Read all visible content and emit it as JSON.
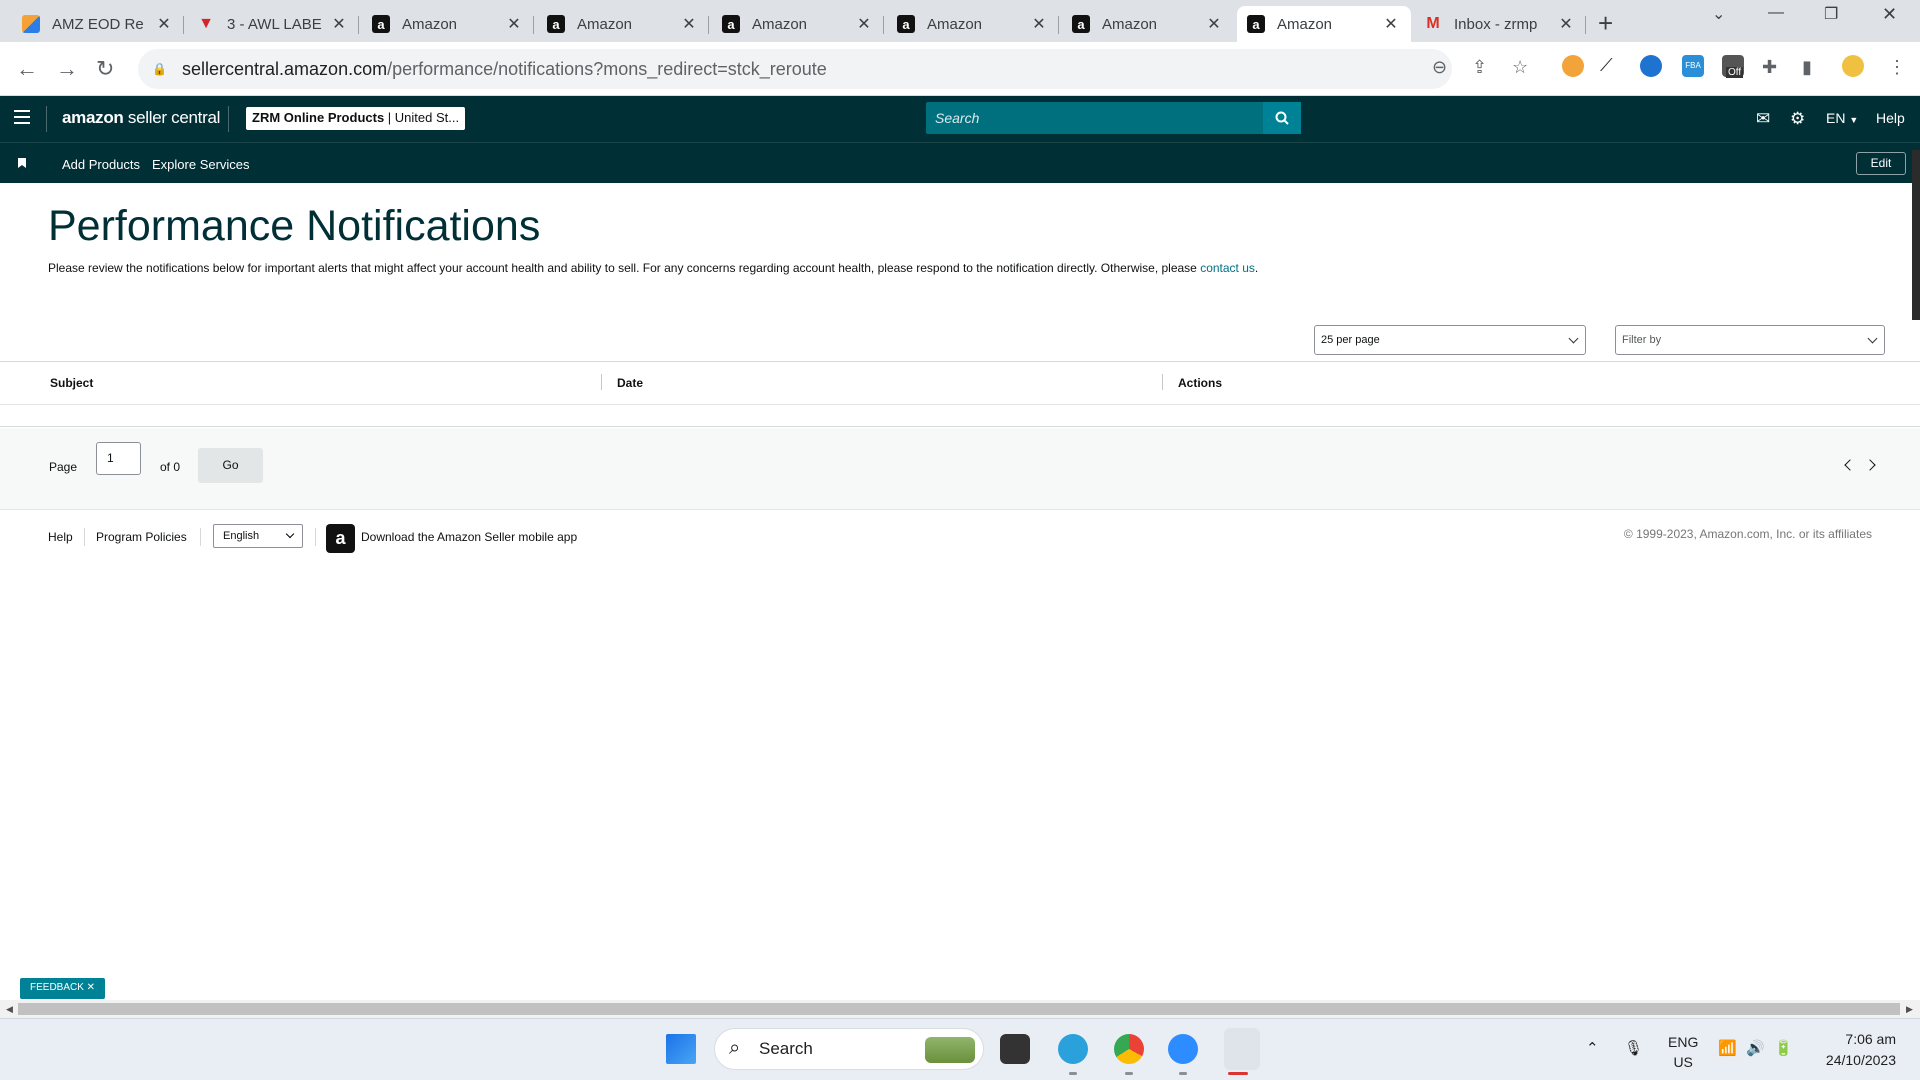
{
  "browser": {
    "tabs": [
      {
        "title": "AMZ EOD Re",
        "favicon": "amz-eod-icon"
      },
      {
        "title": "3 - AWL LABE",
        "favicon": "awl-icon"
      },
      {
        "title": "Amazon",
        "favicon": "amazon-icon"
      },
      {
        "title": "Amazon",
        "favicon": "amazon-icon"
      },
      {
        "title": "Amazon",
        "favicon": "amazon-icon"
      },
      {
        "title": "Amazon",
        "favicon": "amazon-icon"
      },
      {
        "title": "Amazon",
        "favicon": "amazon-icon"
      },
      {
        "title": "Amazon",
        "favicon": "amazon-icon",
        "active": true
      },
      {
        "title": "Inbox - zrmp",
        "favicon": "gmail-icon"
      }
    ],
    "url_host": "sellercentral.amazon.com",
    "url_path": "/performance/notifications?mons_redirect=stck_reroute",
    "ext_badge": "Off"
  },
  "header": {
    "logo_bold": "amazon",
    "logo_light": " seller central",
    "store_name": "ZRM Online Products",
    "store_region": "United St...",
    "search_placeholder": "Search",
    "language": "EN",
    "help": "Help"
  },
  "subnav": {
    "links": [
      "Add Products",
      "Explore Services"
    ],
    "edit": "Edit"
  },
  "main": {
    "title": "Performance Notifications",
    "intro_text": "Please review the notifications below for important alerts that might affect your account health and ability to sell. For any concerns regarding account health, please respond to the notification directly. Otherwise, please ",
    "intro_link": "contact us",
    "intro_end": ".",
    "per_page": "25 per page",
    "filter_placeholder": "Filter by",
    "columns": [
      "Subject",
      "Date",
      "Actions"
    ]
  },
  "pager": {
    "page_label": "Page",
    "page_value": "1",
    "of_label": "of 0",
    "go": "Go"
  },
  "footer": {
    "help": "Help",
    "policies": "Program Policies",
    "language": "English",
    "app_text": "Download the Amazon Seller mobile app",
    "copyright": "© 1999-2023, Amazon.com, Inc. or its affiliates"
  },
  "feedback": "FEEDBACK ✕",
  "taskbar": {
    "search": "Search",
    "lang_top": "ENG",
    "lang_bottom": "US",
    "time": "7:06 am",
    "date": "24/10/2023"
  },
  "colors": {
    "header_bg": "#002f36",
    "search_bg": "#00707e",
    "accent": "#008296",
    "link": "#007185"
  }
}
